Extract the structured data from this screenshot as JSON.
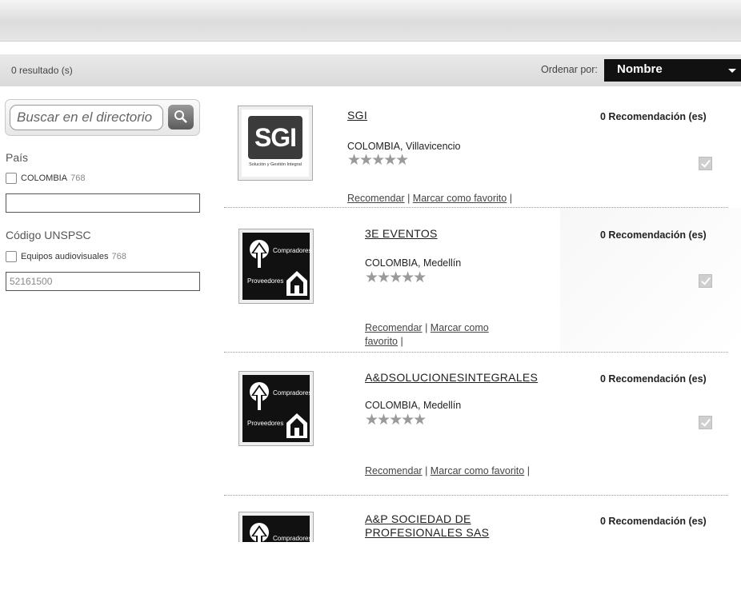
{
  "results": {
    "count_label": "0 resultado (s)",
    "sort_label": "Ordenar por:",
    "sort_value": "Nombre"
  },
  "sidebar": {
    "search_placeholder": "Buscar en el directorio",
    "country_title": "País",
    "country_option": {
      "label": "COLOMBIA",
      "count": "768",
      "checked": false
    },
    "country_filter_value": "",
    "unspsc_title": "Código UNSPSC",
    "unspsc_option": {
      "label": "Equipos audiovisuales",
      "count": "768",
      "checked": false
    },
    "unspsc_filter_value": "52161500"
  },
  "listings": [
    {
      "name": "SGI",
      "logo": "sgi-logo",
      "logo_text": "SGI",
      "logo_subtext": "Solución y Gestión Integral",
      "recommendations": "0 Recomendación (es)",
      "country": "COLOMBIA",
      "city": "Villavicencio",
      "rating": 0,
      "stars": "★★★★★",
      "recommend_label": "Recomendar",
      "favorite_label": "Marcar como favorito",
      "pipe": "|"
    },
    {
      "name": "3E EVENTOS",
      "logo": "compradores-proveedores-logo",
      "logo_top": "Compradores",
      "logo_bottom": "Proveedores",
      "recommendations": "0 Recomendación (es)",
      "country": "COLOMBIA",
      "city": "Medellín",
      "rating": 0,
      "stars": "★★★★★",
      "recommend_label": "Recomendar",
      "favorite_label_line1": "Marcar como",
      "favorite_label_line2": "favorito",
      "pipe": "|"
    },
    {
      "name": "A&DSOLUCIONESINTEGRALES",
      "logo": "compradores-proveedores-logo",
      "logo_top": "Compradores",
      "logo_bottom": "Proveedores",
      "recommendations": "0 Recomendación (es)",
      "country": "COLOMBIA",
      "city": "Medellín",
      "rating": 0,
      "stars": "★★★★★",
      "recommend_label": "Recomendar",
      "favorite_label": "Marcar como favorito",
      "pipe": "|"
    },
    {
      "name_line1": "A&P SOCIEDAD DE",
      "name_line2": "PROFESIONALES SAS",
      "logo": "compradores-proveedores-logo",
      "logo_top": "Compradores",
      "recommendations": "0 Recomendación (es)"
    }
  ],
  "colors": {
    "sort_bg": "#111111",
    "star": "#9a9a9a",
    "accent_dark": "#3b3b3b"
  }
}
